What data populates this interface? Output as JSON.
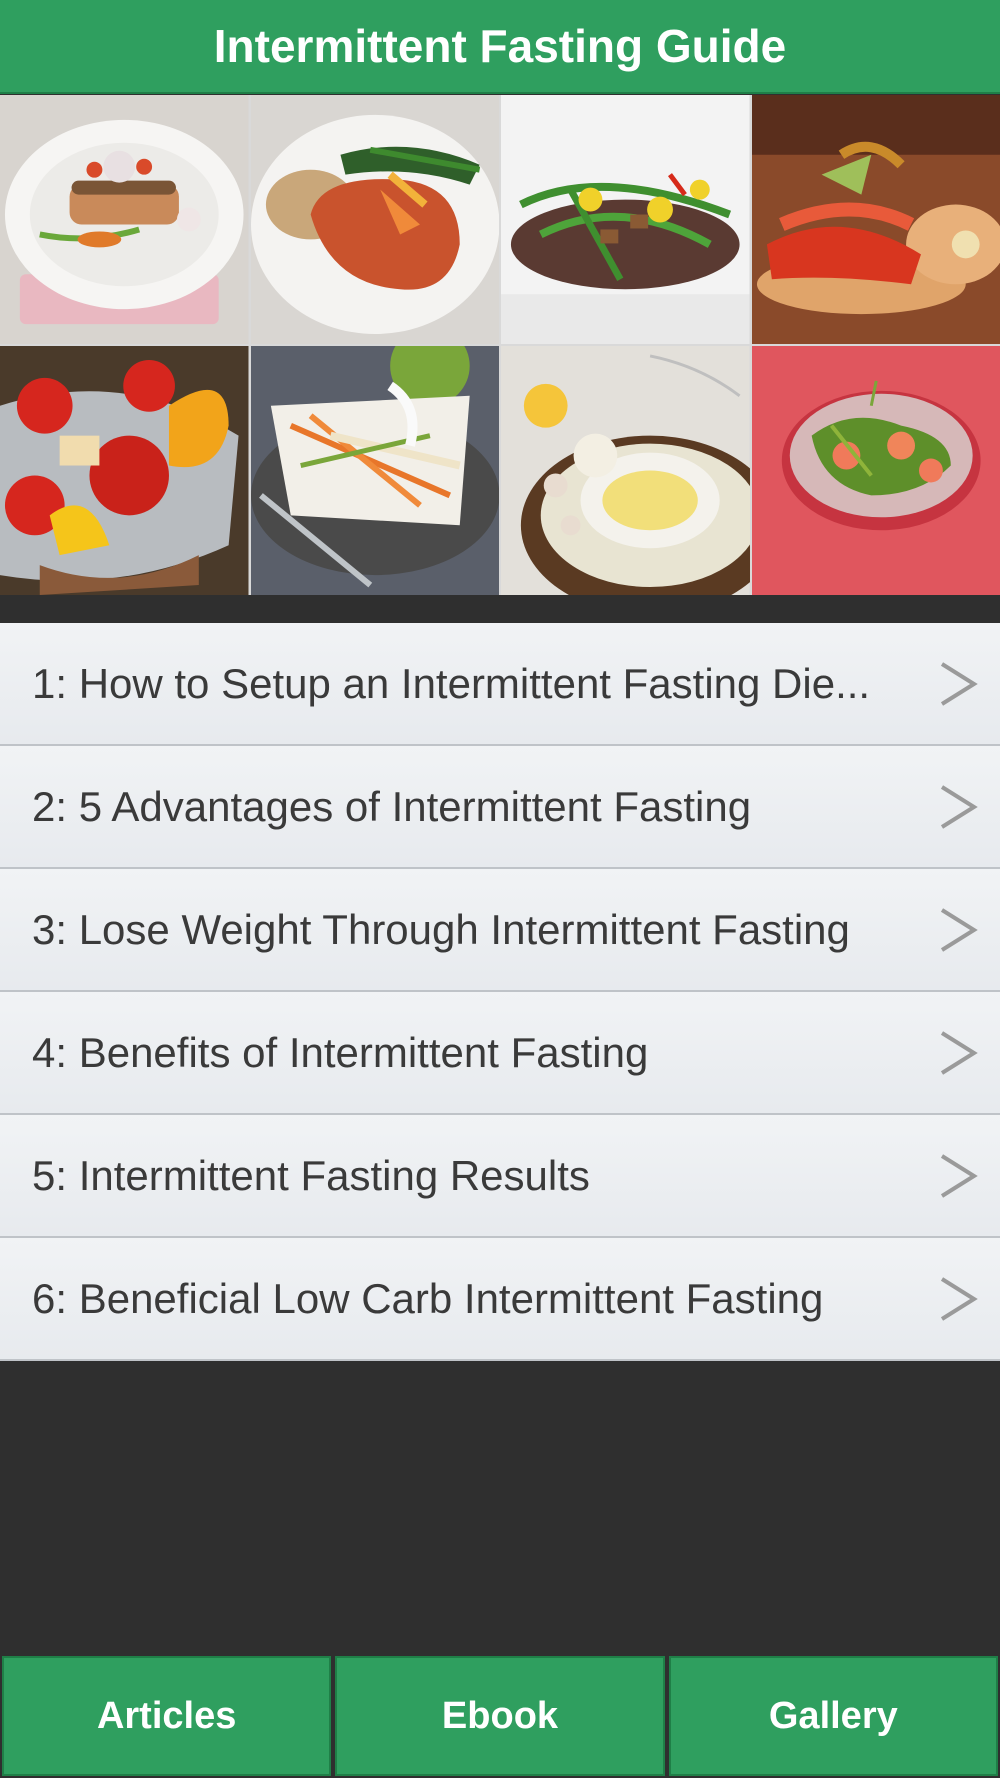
{
  "header": {
    "title": "Intermittent Fasting Guide"
  },
  "gallery": [
    {
      "name": "salmon-plate-image"
    },
    {
      "name": "glazed-salmon-image"
    },
    {
      "name": "green-bean-stirfry-image"
    },
    {
      "name": "tostada-image"
    },
    {
      "name": "fruit-bowl-image"
    },
    {
      "name": "slaw-salad-image"
    },
    {
      "name": "butter-dip-image"
    },
    {
      "name": "grapefruit-salad-image"
    }
  ],
  "articles": [
    {
      "label": "1: How to Setup an Intermittent Fasting Die..."
    },
    {
      "label": "2: 5 Advantages of Intermittent Fasting"
    },
    {
      "label": "3: Lose Weight Through Intermittent Fasting"
    },
    {
      "label": "4: Benefits of Intermittent Fasting"
    },
    {
      "label": "5: Intermittent Fasting Results"
    },
    {
      "label": "6: Beneficial Low Carb Intermittent Fasting"
    }
  ],
  "tabs": [
    {
      "label": "Articles"
    },
    {
      "label": "Ebook"
    },
    {
      "label": "Gallery"
    }
  ],
  "colors": {
    "accent": "#2f9f5f",
    "background": "#2f2f2f",
    "list_bg": "#eceff2"
  }
}
